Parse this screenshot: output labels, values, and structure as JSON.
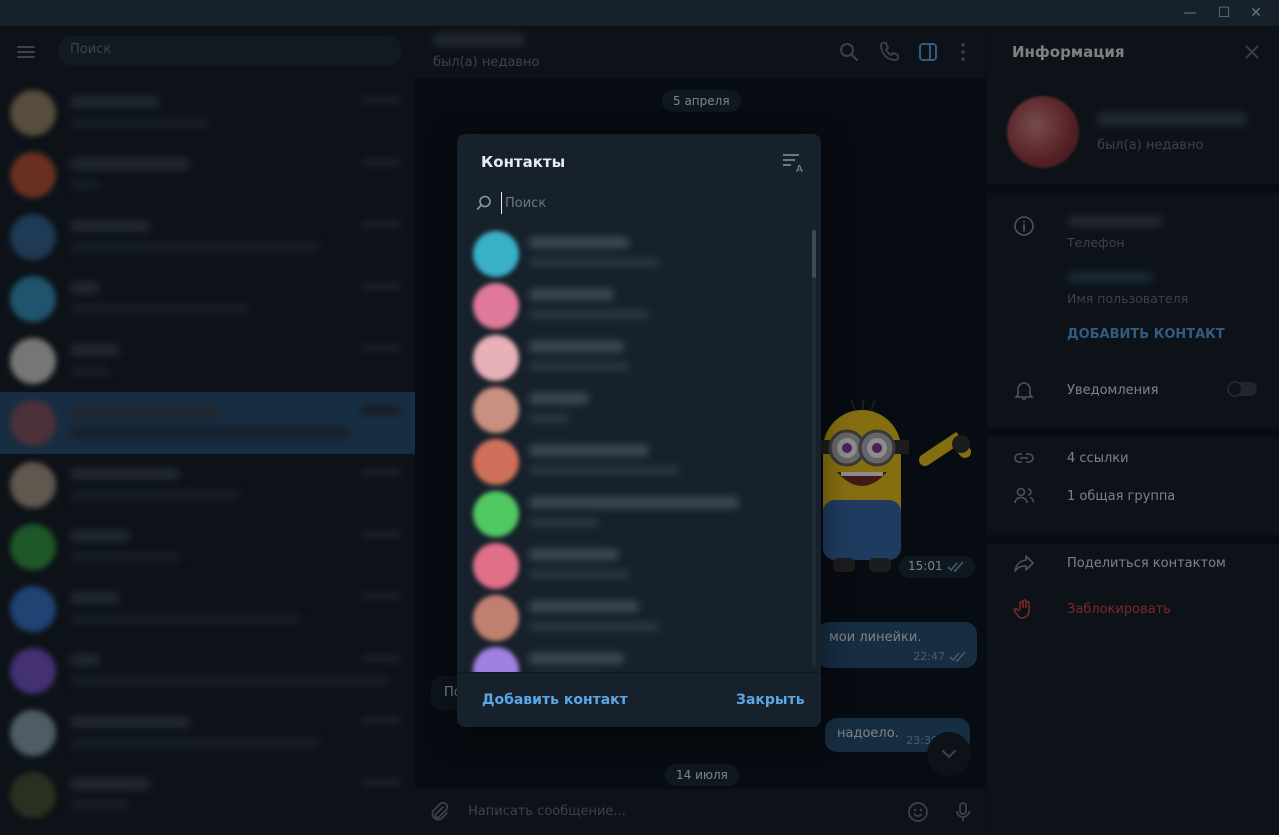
{
  "window": {
    "minimize": "—",
    "maximize": "☐",
    "close": "✕"
  },
  "left": {
    "search_placeholder": "Поиск",
    "chats": [
      {
        "avatar_color": "#a08a70"
      },
      {
        "avatar_color": "#c0583e"
      },
      {
        "avatar_color": "#3a6a9a"
      },
      {
        "avatar_color": "#3a9ac8"
      },
      {
        "avatar_color": "#d8d8d8"
      },
      {
        "avatar_color": "#8a5a6a",
        "active": true
      },
      {
        "avatar_color": "#b0a090"
      },
      {
        "avatar_color": "#3aa04a"
      },
      {
        "avatar_color": "#3a7ad0"
      },
      {
        "avatar_color": "#7a5ad0"
      },
      {
        "avatar_color": "#90a8b8"
      },
      {
        "avatar_color": "#4a5a3a"
      }
    ]
  },
  "chat": {
    "status": "был(а) недавно",
    "date1": "5 апреля",
    "sticker_time": "15:01",
    "msg1_text": "мои линейки.",
    "msg1_time": "22:47",
    "in_msg_text": "По",
    "msg2_text": "надоело.",
    "msg2_time": "23:38",
    "date2": "14 июля",
    "compose_placeholder": "Написать сообщение..."
  },
  "info": {
    "title": "Информация",
    "profile_status": "был(а) недавно",
    "phone_label": "Телефон",
    "username_label": "Имя пользователя",
    "add_contact": "ДОБАВИТЬ КОНТАКТ",
    "notifications": "Уведомления",
    "links": "4 ссылки",
    "groups": "1 общая группа",
    "share": "Поделиться контактом",
    "block": "Заблокировать",
    "accent": "#5ba7e6",
    "danger": "#e0484e"
  },
  "modal": {
    "title": "Контакты",
    "search_placeholder": "Поиск",
    "add_contact": "Добавить контакт",
    "close": "Закрыть",
    "contacts": [
      {
        "avatar_color": "#3ab0c8"
      },
      {
        "avatar_color": "#e07a9a"
      },
      {
        "avatar_color": "#e8b0b8"
      },
      {
        "avatar_color": "#c89080"
      },
      {
        "avatar_color": "#d0705a"
      },
      {
        "avatar_color": "#50c860"
      },
      {
        "avatar_color": "#e0708a"
      },
      {
        "avatar_color": "#c08070"
      },
      {
        "avatar_color": "#a080e0"
      }
    ]
  }
}
